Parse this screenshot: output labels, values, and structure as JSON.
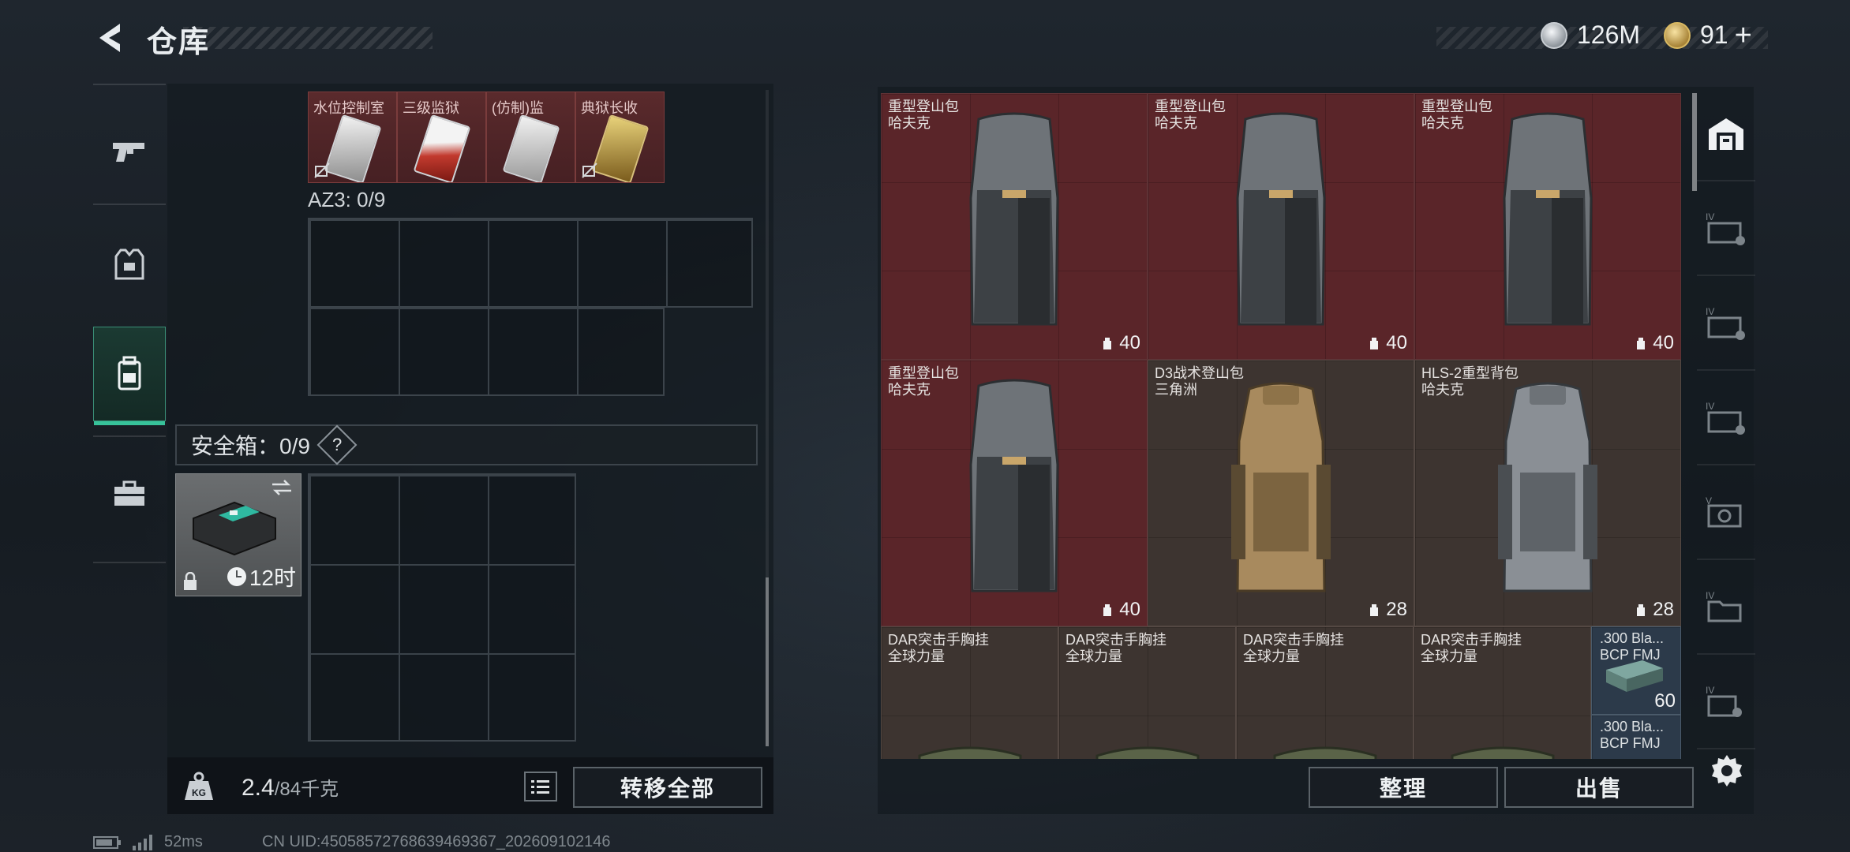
{
  "header": {
    "title": "仓库",
    "currency_silver": "126M",
    "currency_gold": "91",
    "gold_plus": "+"
  },
  "left_nav": {
    "items": [
      {
        "name": "weapon",
        "icon": "pistol-icon"
      },
      {
        "name": "armor",
        "icon": "vest-icon"
      },
      {
        "name": "backpack",
        "icon": "backpack-icon",
        "active": true
      },
      {
        "name": "case",
        "icon": "briefcase-icon"
      }
    ]
  },
  "inventory": {
    "slots": [
      {
        "label": "水位控制室",
        "card": "c1"
      },
      {
        "label": "三级监狱",
        "card": "c2"
      },
      {
        "label": "(仿制)监",
        "card": "c3"
      },
      {
        "label": "典狱长收",
        "card": "c4"
      }
    ],
    "az3_label": "AZ3: 0/9",
    "safe_label": "安全箱：0/9",
    "safe_help": "?",
    "safe_timer": "12时",
    "weight_value": "2.4",
    "weight_max": "/84千克",
    "transfer_all": "转移全部"
  },
  "stash": {
    "items": [
      {
        "name": "重型登山包",
        "brand": "哈夫克",
        "capacity": "40",
        "bg": "red",
        "pack": "gray"
      },
      {
        "name": "重型登山包",
        "brand": "哈夫克",
        "capacity": "40",
        "bg": "red",
        "pack": "gray"
      },
      {
        "name": "重型登山包",
        "brand": "哈夫克",
        "capacity": "40",
        "bg": "red",
        "pack": "gray"
      },
      {
        "name": "重型登山包",
        "brand": "哈夫克",
        "capacity": "40",
        "bg": "red",
        "pack": "gray"
      },
      {
        "name": "D3战术登山包",
        "brand": "三角洲",
        "capacity": "28",
        "bg": "brown",
        "pack": "tan"
      },
      {
        "name": "HLS-2重型背包",
        "brand": "哈夫克",
        "capacity": "28",
        "bg": "brown",
        "pack": "gray2"
      }
    ],
    "rigs": [
      {
        "name": "DAR突击手胸挂",
        "brand": "全球力量"
      },
      {
        "name": "DAR突击手胸挂",
        "brand": "全球力量"
      },
      {
        "name": "DAR突击手胸挂",
        "brand": "全球力量"
      },
      {
        "name": "DAR突击手胸挂",
        "brand": "全球力量"
      }
    ],
    "ammo": [
      {
        "line1": ".300 Bla...",
        "line2": "BCP FMJ",
        "count": "60"
      },
      {
        "line1": ".300 Bla...",
        "line2": "BCP FMJ",
        "count": ""
      }
    ],
    "sort_button": "整理",
    "sell_button": "出售"
  },
  "status_bar": {
    "ping": "52ms",
    "uid": "CN UID:4505857276863946936‌7_202609102146"
  },
  "colors": {
    "accent": "#37c29a",
    "red_cell": "#5a2529",
    "brown_cell": "#3d3430"
  }
}
